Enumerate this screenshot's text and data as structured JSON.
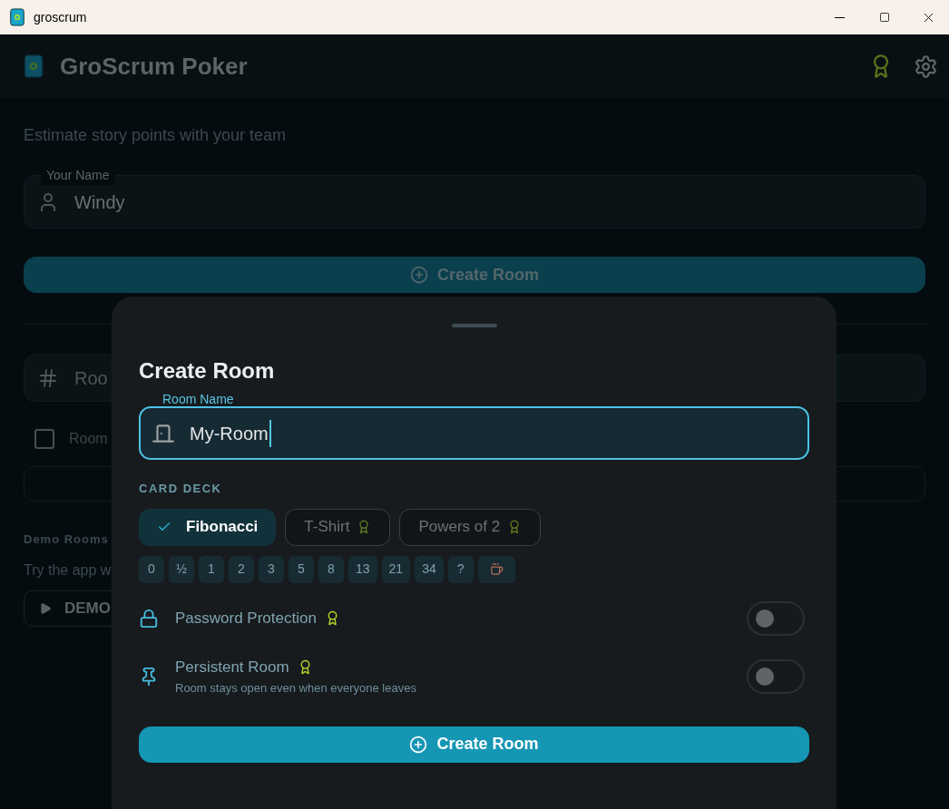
{
  "window": {
    "title": "groscrum"
  },
  "header": {
    "title": "GroScrum Poker"
  },
  "background": {
    "subtitle": "Estimate story points with your team",
    "name_field": {
      "label": "Your Name",
      "value": "Windy"
    },
    "create_button": "Create Room",
    "room_field": {
      "placeholder": "Roo"
    },
    "checkbox": {
      "label": "Room",
      "checked": false
    },
    "demo_heading": "Demo Rooms",
    "demo_text": "Try the app w",
    "demo_button": "DEMO"
  },
  "sheet": {
    "title": "Create Room",
    "room_name_field": {
      "label": "Room Name",
      "value": "My-Room"
    },
    "deck_label": "CARD DECK",
    "decks": [
      {
        "label": "Fibonacci",
        "selected": true,
        "premium": false
      },
      {
        "label": "T-Shirt",
        "selected": false,
        "premium": true
      },
      {
        "label": "Powers of 2",
        "selected": false,
        "premium": true
      }
    ],
    "cards": [
      {
        "kind": "text",
        "label": "0"
      },
      {
        "kind": "text",
        "label": "½"
      },
      {
        "kind": "text",
        "label": "1"
      },
      {
        "kind": "text",
        "label": "2"
      },
      {
        "kind": "text",
        "label": "3"
      },
      {
        "kind": "text",
        "label": "5"
      },
      {
        "kind": "text",
        "label": "8"
      },
      {
        "kind": "text",
        "label": "13"
      },
      {
        "kind": "text",
        "label": "21"
      },
      {
        "kind": "text",
        "label": "34"
      },
      {
        "kind": "text",
        "label": "?"
      },
      {
        "kind": "coffee"
      }
    ],
    "options": [
      {
        "kind": "lock",
        "label": "Password Protection",
        "premium": true,
        "on": false
      },
      {
        "kind": "pin",
        "label": "Persistent Room",
        "premium": true,
        "description": "Room stays open even when everyone leaves",
        "on": false
      }
    ],
    "submit": "Create Room"
  }
}
